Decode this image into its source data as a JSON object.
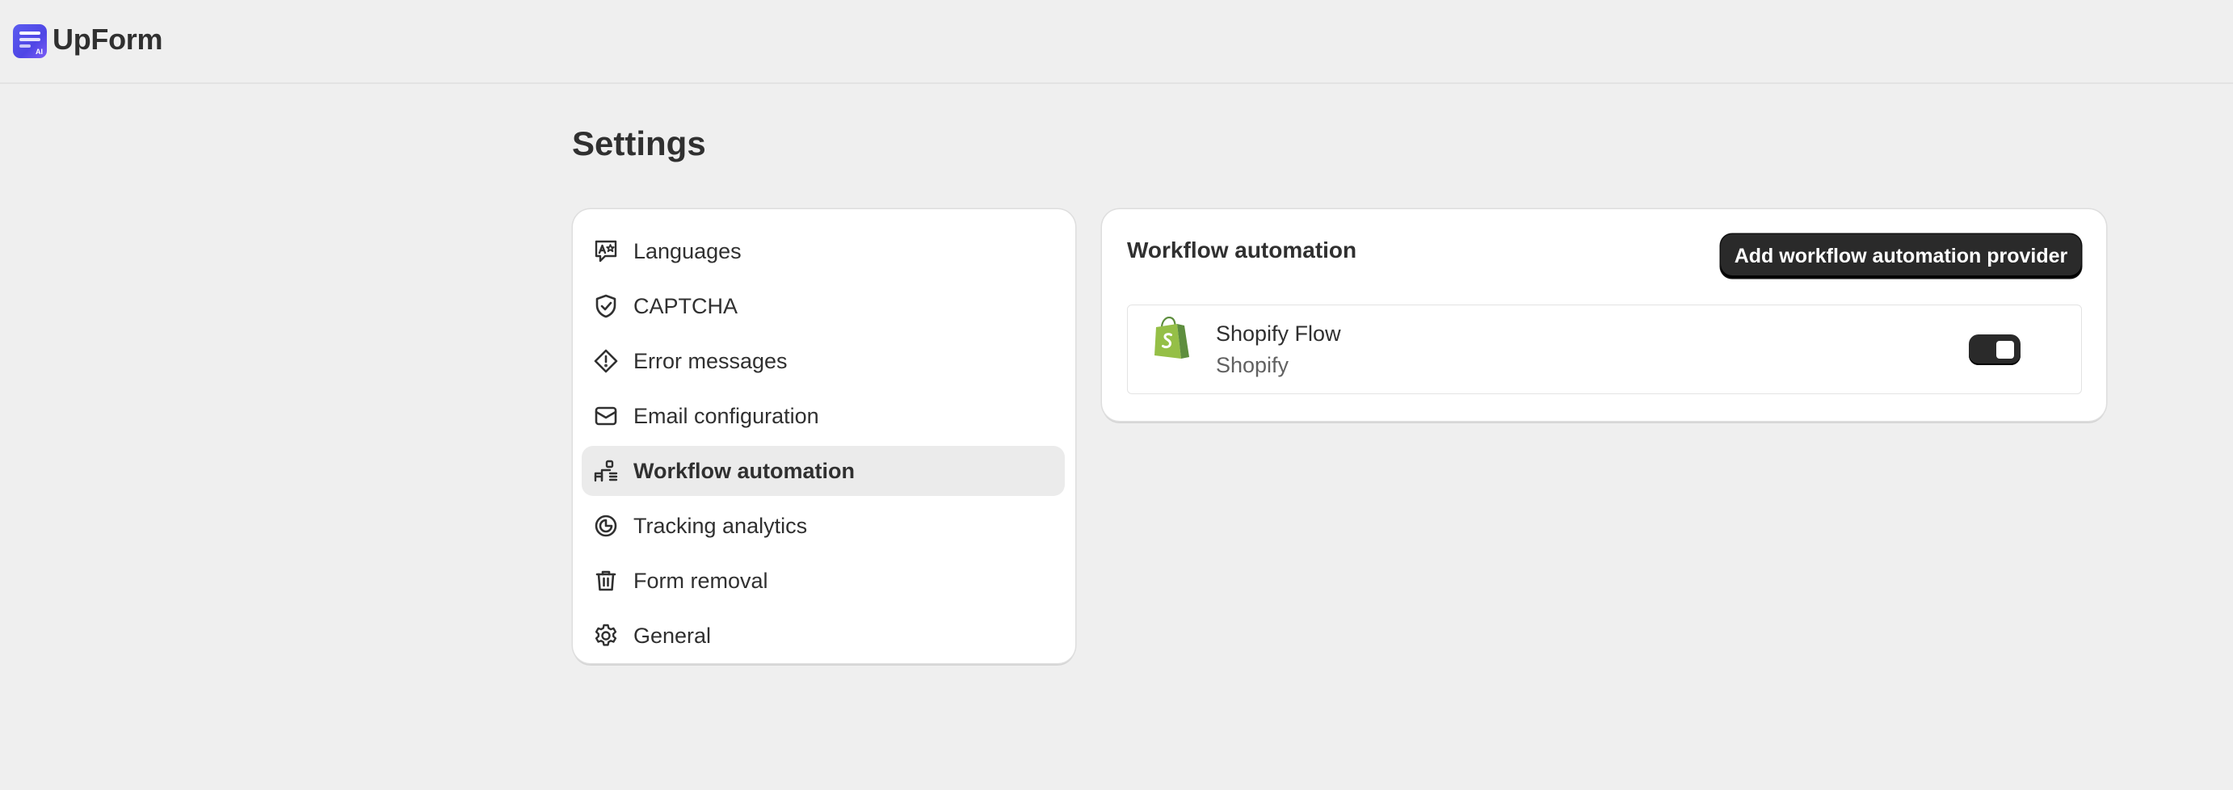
{
  "app": {
    "name": "UpForm",
    "logo_icon": "upform-logo-icon"
  },
  "page": {
    "title": "Settings"
  },
  "menu": {
    "items": [
      {
        "label": "Languages",
        "icon": "language-icon",
        "active": false
      },
      {
        "label": "CAPTCHA",
        "icon": "shield-check-icon",
        "active": false
      },
      {
        "label": "Error messages",
        "icon": "alert-diamond-icon",
        "active": false
      },
      {
        "label": "Email configuration",
        "icon": "email-icon",
        "active": false
      },
      {
        "label": "Workflow automation",
        "icon": "workflow-icon",
        "active": true
      },
      {
        "label": "Tracking analytics",
        "icon": "analytics-icon",
        "active": false
      },
      {
        "label": "Form removal",
        "icon": "trash-icon",
        "active": false
      },
      {
        "label": "General",
        "icon": "gear-icon",
        "active": false
      }
    ]
  },
  "workflow": {
    "title": "Workflow automation",
    "add_button_label": "Add workflow automation provider",
    "providers": [
      {
        "name": "Shopify Flow",
        "vendor": "Shopify",
        "icon": "shopify-bag-icon",
        "enabled": true
      }
    ]
  },
  "colors": {
    "background": "#efefef",
    "card": "#ffffff",
    "primary_button": "#2a2a2a",
    "active_menu": "#ebebeb",
    "brand_logo": "#5b5cf0",
    "shopify_green": "#95bf47"
  }
}
